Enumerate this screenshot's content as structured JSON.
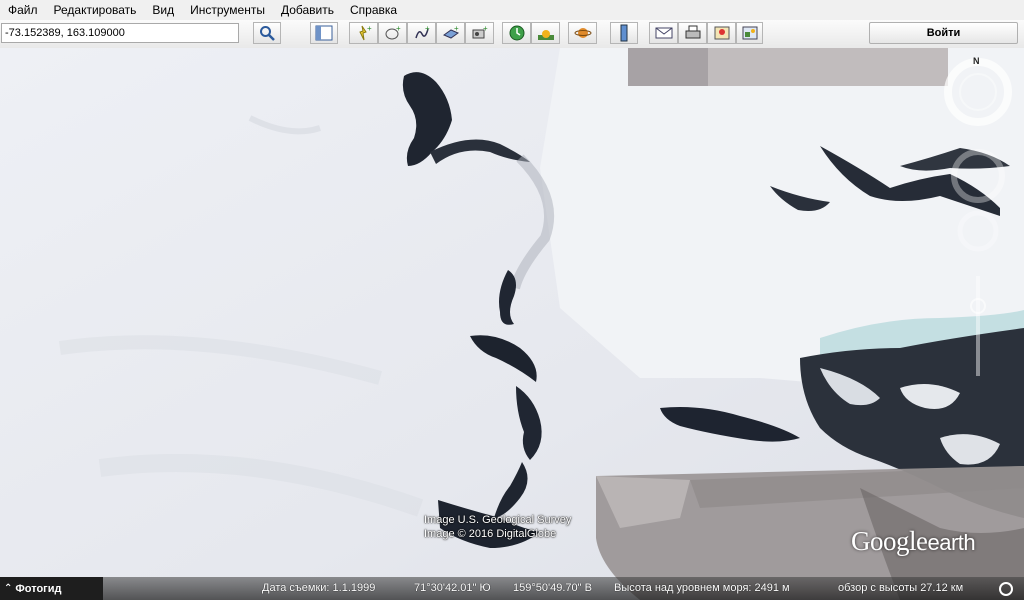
{
  "menu": {
    "items": [
      {
        "label": "Файл"
      },
      {
        "label": "Редактировать"
      },
      {
        "label": "Вид"
      },
      {
        "label": "Инструменты"
      },
      {
        "label": "Добавить"
      },
      {
        "label": "Справка"
      }
    ]
  },
  "toolbar": {
    "search_value": "-73.152389, 163.109000",
    "login_label": "Войти",
    "icons": [
      "search-icon",
      "sidebar-icon",
      "placemark-icon",
      "polygon-icon",
      "path-icon",
      "image-overlay-icon",
      "record-tour-icon",
      "historical-imagery-icon",
      "sunlight-icon",
      "planets-icon",
      "ruler-icon",
      "email-icon",
      "print-icon",
      "maps-icon",
      "save-image-icon"
    ]
  },
  "map": {
    "credit_line1": "Image U.S. Geological Survey",
    "credit_line2": "Image © 2016 DigitalGlobe",
    "logo_google": "Google",
    "logo_earth": "earth",
    "compass_north": "N"
  },
  "status": {
    "photo_tab_label": "Фотогид",
    "imagery_date": "Дата съемки: 1.1.1999",
    "latitude": "71°30'42.01\" Ю",
    "longitude": "159°50'49.70\" В",
    "elevation": "Высота над уровнем моря:  2491 м",
    "eye_alt": "обзор с высоты  27.12 км"
  },
  "colors": {
    "snow": "#eceef3",
    "rock": "#1f2530",
    "ice": "#b9dce0",
    "menu_bg": "#f0f0f0"
  }
}
